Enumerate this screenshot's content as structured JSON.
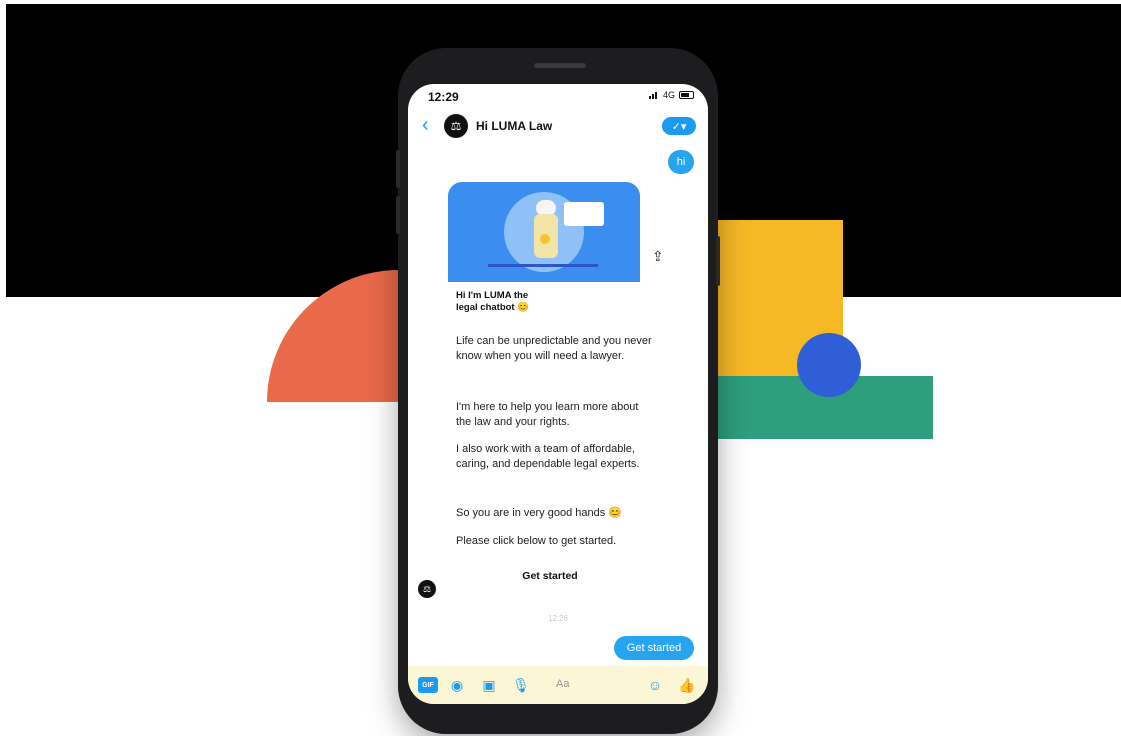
{
  "colors": {
    "accent": "#1a9bf0",
    "bubble": "#27a4f0",
    "orange": "#e9694a",
    "yellow": "#f7b826",
    "green": "#2e9e7c",
    "blue": "#2f5ed6"
  },
  "status_bar": {
    "time": "12:29",
    "network": "4G"
  },
  "header": {
    "title": "Hi LUMA Law",
    "back_icon": "chevron-left-icon",
    "action_icon": "checkmark-icon"
  },
  "messages": {
    "user_hi": "hi",
    "card_title_line1": "Hi I'm LUMA the",
    "card_title_line2": "legal chatbot",
    "paragraph1": "Life can be unpredictable and you never know when you will need a lawyer.",
    "paragraph2": "I'm here to help you learn more about the law and your rights.",
    "paragraph3": "I also work with a team of affordable, caring, and dependable legal experts.",
    "paragraph4": "So you are in very good hands",
    "paragraph5": "Please click below to get started.",
    "card_button": "Get started",
    "timestamp": "12:26",
    "user_get_started": "Get started"
  },
  "composer": {
    "placeholder": "Aa",
    "gif_label": "GIF"
  }
}
